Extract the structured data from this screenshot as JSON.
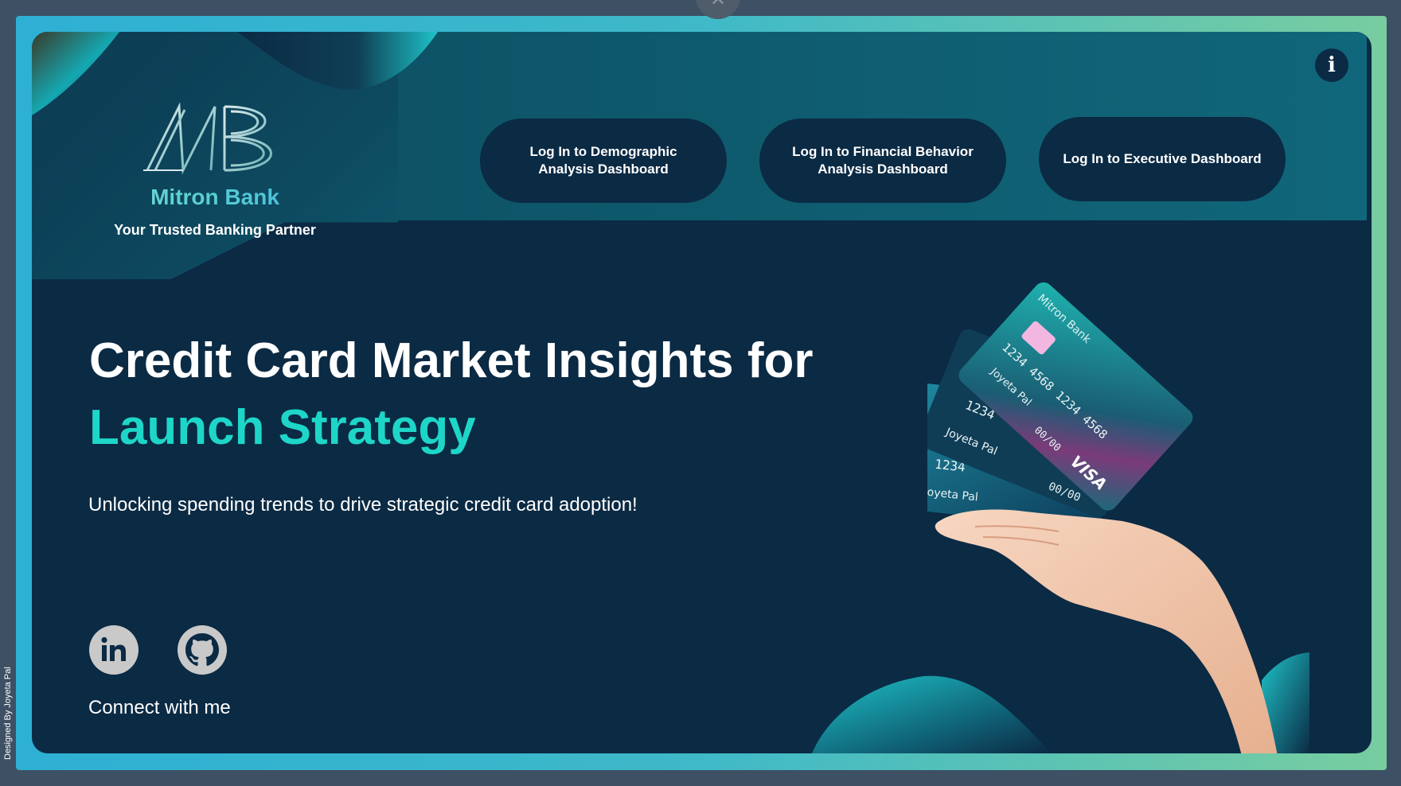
{
  "app": {
    "credit": "Designed By Joyeta Pal"
  },
  "brand": {
    "name": "Mitron Bank",
    "tagline": "Your Trusted Banking Partner",
    "logo_icon": "mb-monogram-icon"
  },
  "nav": {
    "buttons": [
      {
        "label": "Log In to Demographic Analysis Dashboard"
      },
      {
        "label": "Log In to Financial Behavior Analysis Dashboard"
      },
      {
        "label": "Log In to Executive Dashboard"
      }
    ],
    "info_icon": "info-icon"
  },
  "hero": {
    "title_line1": "Credit Card Market Insights for",
    "title_line2": "Launch Strategy",
    "subtitle": "Unlocking spending trends to drive strategic credit card adoption!"
  },
  "social": {
    "connect_label": "Connect with me",
    "links": [
      {
        "icon": "linkedin-icon"
      },
      {
        "icon": "github-icon"
      }
    ]
  },
  "illustration": {
    "card_bank": "Mitron Bank",
    "card_brand": "VISA",
    "card_number": "1234 4568 1234 4568",
    "card_short": "1234",
    "card_holder": "Joyeta Pal",
    "card_expiry": "00/00"
  },
  "colors": {
    "background": "#0b2a44",
    "accent": "#1ed6c8",
    "frame_gradient_start": "#2eb0d4",
    "frame_gradient_end": "#78cda0"
  }
}
